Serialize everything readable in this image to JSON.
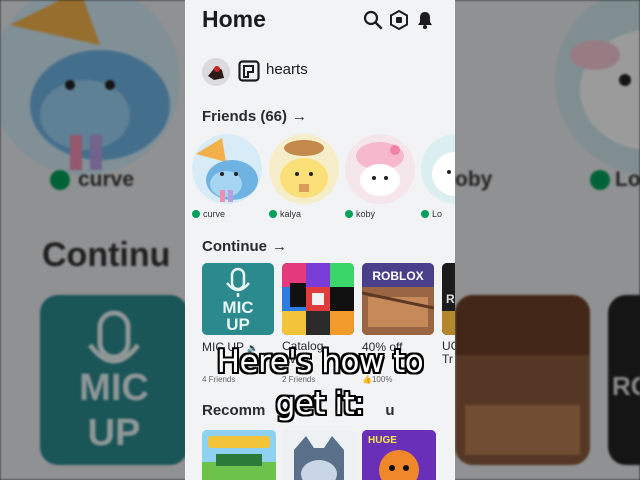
{
  "header": {
    "title": "Home"
  },
  "icons": [
    "search-icon",
    "robux-icon",
    "notification-bell-icon",
    "premium-icon"
  ],
  "user": {
    "name": "hearts"
  },
  "friends": {
    "title": "Friends (66)",
    "arrow": "→",
    "items": [
      {
        "name": "curve"
      },
      {
        "name": "kalya"
      },
      {
        "name": "koby"
      },
      {
        "name": "Lo"
      }
    ]
  },
  "continue": {
    "title": "Continue",
    "arrow": "→",
    "games": [
      {
        "name": "MIC UP",
        "sub": "4 Friends",
        "tile_text_1": "MIC",
        "tile_text_2": "UP"
      },
      {
        "name": "Catalog",
        "name2": "Avat",
        "sub": "2 Friends"
      },
      {
        "name": "40% off",
        "sub": "100%",
        "tile_text": "ROBLOX"
      },
      {
        "name": "UG",
        "name2": "Tr",
        "tile_text": "ROBLOX"
      }
    ]
  },
  "recommended": {
    "title": "Recomm",
    "title_end": "u"
  },
  "tiles_text": {
    "rec_2": "HUGE"
  },
  "background": {
    "friend_names": [
      "curve",
      "oby",
      "Lo"
    ],
    "heading": "Continu",
    "tile_mic": "MIC",
    "tile_up": "UP",
    "tile_roblox": "ROBLOX"
  },
  "caption": {
    "line1": "Here's how to",
    "line2": "get it:"
  },
  "colors": {
    "online": "#00a05a",
    "micup_teal": "#2a8a8e",
    "panel_bg": "#f2f3f5"
  }
}
